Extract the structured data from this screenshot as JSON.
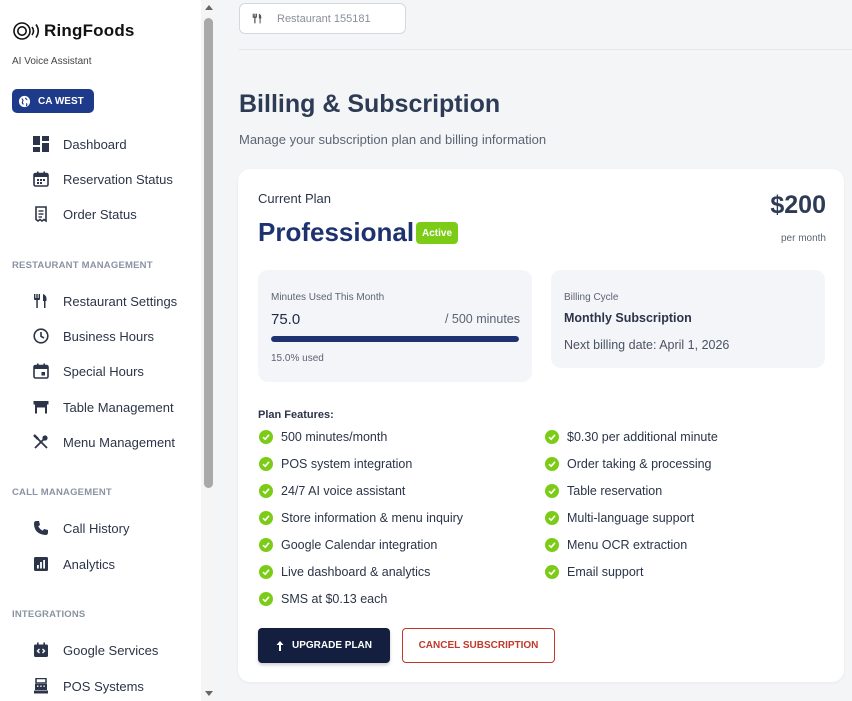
{
  "brand": {
    "name": "RingFoods",
    "subtitle": "AI Voice Assistant"
  },
  "region": {
    "label": "CA WEST"
  },
  "sidebar": {
    "main_items": [
      {
        "label": "Dashboard",
        "icon": "dashboard-icon"
      },
      {
        "label": "Reservation Status",
        "icon": "calendar-icon"
      },
      {
        "label": "Order Status",
        "icon": "receipt-icon"
      }
    ],
    "sections": [
      {
        "title": "RESTAURANT MANAGEMENT",
        "items": [
          {
            "label": "Restaurant Settings",
            "icon": "fork-knife-icon"
          },
          {
            "label": "Business Hours",
            "icon": "clock-icon"
          },
          {
            "label": "Special Hours",
            "icon": "calendar-event-icon"
          },
          {
            "label": "Table Management",
            "icon": "table-icon"
          },
          {
            "label": "Menu Management",
            "icon": "utensils-cross-icon"
          }
        ]
      },
      {
        "title": "CALL MANAGEMENT",
        "items": [
          {
            "label": "Call History",
            "icon": "phone-icon"
          },
          {
            "label": "Analytics",
            "icon": "analytics-icon"
          }
        ]
      },
      {
        "title": "INTEGRATIONS",
        "items": [
          {
            "label": "Google Services",
            "icon": "code-calendar-icon"
          },
          {
            "label": "POS Systems",
            "icon": "pos-register-icon"
          }
        ]
      }
    ]
  },
  "restaurant_selector": {
    "value": "Restaurant 155181"
  },
  "page": {
    "title": "Billing & Subscription",
    "subtitle": "Manage your subscription plan and billing information"
  },
  "plan": {
    "current_label": "Current Plan",
    "name": "Professional",
    "status": "Active",
    "price": "$200",
    "price_period": "per month"
  },
  "usage": {
    "label": "Minutes Used This Month",
    "used": "75.0",
    "limit": "/ 500 minutes",
    "percent_text": "15.0% used",
    "fill_fraction": 1.0
  },
  "billing": {
    "label": "Billing Cycle",
    "cycle": "Monthly Subscription",
    "next_date": "Next billing date: April 1, 2026"
  },
  "features": {
    "title": "Plan Features:",
    "left": [
      "500 minutes/month",
      "POS system integration",
      "24/7 AI voice assistant",
      "Store information & menu inquiry",
      "Google Calendar integration",
      "Live dashboard & analytics",
      "SMS at $0.13 each"
    ],
    "right": [
      "$0.30 per additional minute",
      "Order taking & processing",
      "Table reservation",
      "Multi-language support",
      "Menu OCR extraction",
      "Email support"
    ]
  },
  "actions": {
    "upgrade": "UPGRADE PLAN",
    "cancel": "CANCEL SUBSCRIPTION"
  },
  "colors": {
    "primary": "#1e3270",
    "accent_green": "#7ccc17",
    "danger": "#c0392b",
    "dark_button": "#141f3f"
  }
}
